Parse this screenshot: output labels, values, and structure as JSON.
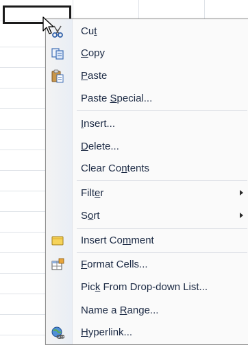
{
  "menu": {
    "items": [
      {
        "pre": "Cu",
        "mn": "t",
        "post": "",
        "icon": "scissors-icon"
      },
      {
        "pre": "",
        "mn": "C",
        "post": "opy",
        "icon": "copy-icon"
      },
      {
        "pre": "",
        "mn": "P",
        "post": "aste",
        "icon": "paste-icon"
      },
      {
        "pre": "Paste ",
        "mn": "S",
        "post": "pecial...",
        "icon": ""
      },
      {
        "pre": "",
        "mn": "I",
        "post": "nsert...",
        "icon": ""
      },
      {
        "pre": "",
        "mn": "D",
        "post": "elete...",
        "icon": ""
      },
      {
        "pre": "Clear Co",
        "mn": "n",
        "post": "tents",
        "icon": ""
      },
      {
        "pre": "Filt",
        "mn": "e",
        "post": "r",
        "icon": "",
        "submenu": true
      },
      {
        "pre": "S",
        "mn": "o",
        "post": "rt",
        "icon": "",
        "submenu": true
      },
      {
        "pre": "Insert Co",
        "mn": "m",
        "post": "ment",
        "icon": "comment-icon"
      },
      {
        "pre": "",
        "mn": "F",
        "post": "ormat Cells...",
        "icon": "format-cells-icon"
      },
      {
        "pre": "Pic",
        "mn": "k",
        "post": " From Drop-down List...",
        "icon": ""
      },
      {
        "pre": "Name a ",
        "mn": "R",
        "post": "ange...",
        "icon": ""
      },
      {
        "pre": "",
        "mn": "H",
        "post": "yperlink...",
        "icon": "hyperlink-icon"
      }
    ]
  }
}
